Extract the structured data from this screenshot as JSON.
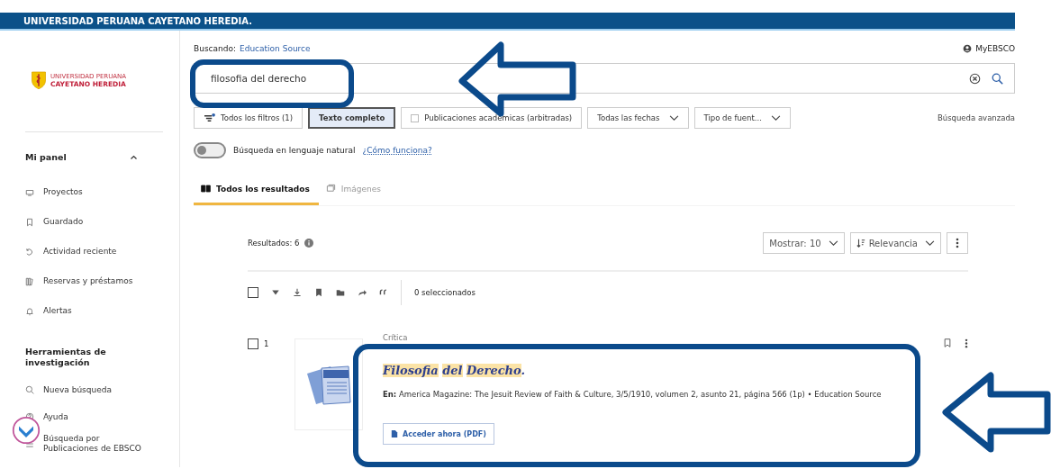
{
  "banner": {
    "title": "UNIVERSIDAD PERUANA CAYETANO HEREDIA."
  },
  "logo": {
    "small": "UNIVERSIDAD PERUANA",
    "big": "CAYETANO HEREDIA"
  },
  "sidebar": {
    "sections": [
      {
        "title": "Mi panel",
        "expanded": true,
        "items": [
          {
            "label": "Proyectos"
          },
          {
            "label": "Guardado"
          },
          {
            "label": "Actividad reciente"
          },
          {
            "label": "Reservas y préstamos"
          },
          {
            "label": "Alertas"
          }
        ]
      },
      {
        "title": "Herramientas de investigación",
        "items": [
          {
            "label": "Nueva búsqueda"
          },
          {
            "label": "Ayuda"
          },
          {
            "label": "Búsqueda por Publicaciones de EBSCO"
          }
        ]
      }
    ]
  },
  "searching": {
    "label": "Buscando:",
    "source": "Education Source"
  },
  "account": {
    "label": "MyEBSCO"
  },
  "search": {
    "value": "filosofia del derecho"
  },
  "filters": [
    {
      "kind": "filters",
      "label": "Todos los filtros (1)",
      "selected": false
    },
    {
      "kind": "toggle",
      "label": "Texto completo",
      "selected": true
    },
    {
      "kind": "checkbox",
      "label": "Publicaciones académicas (arbitradas)",
      "selected": false
    },
    {
      "kind": "dropdown",
      "label": "Todas las fechas",
      "selected": false
    },
    {
      "kind": "dropdown",
      "label": "Tipo de fuent...",
      "selected": false
    }
  ],
  "advanced_search": "Búsqueda avanzada",
  "natural_language": {
    "label": "Búsqueda en lenguaje natural",
    "on": false,
    "link": "¿Cómo funciona?"
  },
  "tabs": [
    {
      "label": "Todos los resultados",
      "selected": true
    },
    {
      "label": "Imágenes",
      "selected": false
    }
  ],
  "results_count": "Resultados: 6",
  "show": "Mostrar: 10",
  "sort": "Relevancia",
  "select_all": {
    "checked": false
  },
  "selected_count": "0 seleccionados",
  "results": [
    {
      "number": "1",
      "checked": false,
      "type": "Crítica",
      "title_parts": [
        {
          "kind": "word",
          "text": "Filosofia",
          "highlighted": true
        },
        {
          "kind": "word",
          "text": "del",
          "highlighted": true
        },
        {
          "kind": "word",
          "text": "Derecho",
          "highlighted": true
        },
        {
          "kind": "punctuation",
          "text": ".",
          "highlighted": false
        }
      ],
      "source": "**En:** America Magazine: The Jesuit Review of Faith & Culture, 3/5/1910, volumen 2, asunto 21, página 566 (1p) • Education Source",
      "access": "Acceder ahora (PDF)"
    }
  ]
}
